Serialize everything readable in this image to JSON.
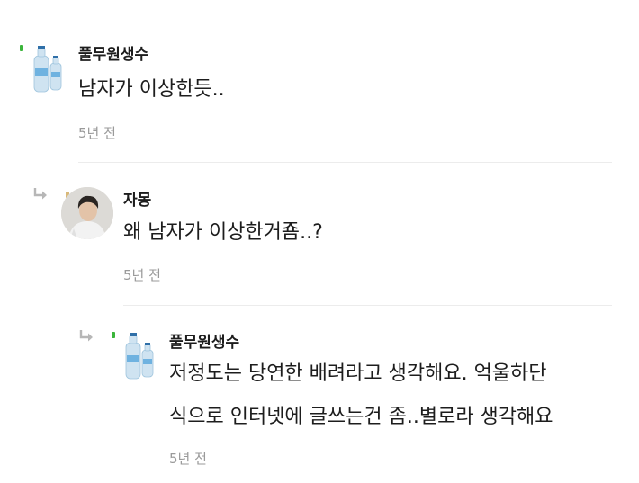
{
  "comments": [
    {
      "nickname": "풀무원생수",
      "lines": [
        "남자가 이상한듯.."
      ],
      "time": "5년 전"
    },
    {
      "nickname": "자몽",
      "lines": [
        "왜 남자가 이상한거죰..?"
      ],
      "time": "5년 전"
    },
    {
      "nickname": "풀무원생수",
      "lines": [
        "저정도는 당연한 배려라고 생각해요. 억울하단",
        "식으로 인터넷에 글쓰는건 좀..별로라 생각해요"
      ],
      "time": "5년 전"
    }
  ],
  "colors": {
    "badge": "#3bb53b",
    "time": "#9a9a9a",
    "divider": "#ececec"
  },
  "icons": {
    "reply": "reply-arrow-icon",
    "avatar_bottle": "water-bottle-avatar",
    "avatar_photo": "profile-photo-avatar"
  }
}
